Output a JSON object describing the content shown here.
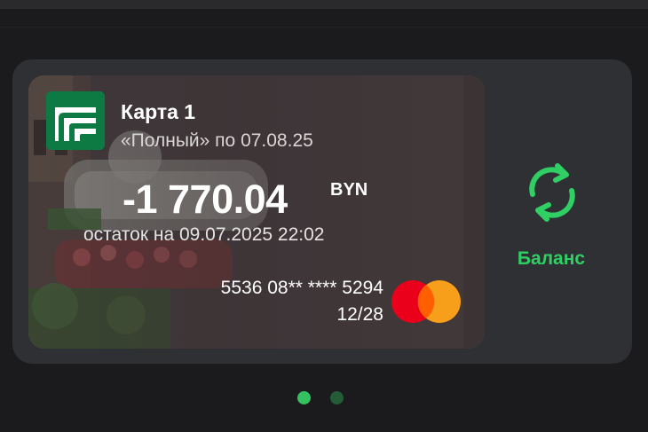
{
  "card": {
    "name": "Карта 1",
    "plan": "«Полный» по 07.08.25",
    "balance_amount": "-1 770.04",
    "currency": "BYN",
    "balance_date": "остаток на 09.07.2025 22:02",
    "number": "5536 08** **** 5294",
    "expiry": "12/28"
  },
  "actions": {
    "balance_label": "Баланс"
  },
  "pagination": {
    "total": 2,
    "active_index": 0
  },
  "icons": {
    "refresh": "refresh-icon",
    "bank_logo": "bank-logo",
    "payment_system": "mastercard-logo"
  },
  "colors": {
    "accent": "#2fcf63",
    "card_bg": "#2f3033",
    "page_bg": "#1b1b1d",
    "logo_green": "#0e7a43",
    "mastercard_red": "#eb001b",
    "mastercard_orange": "#f79e1b"
  }
}
